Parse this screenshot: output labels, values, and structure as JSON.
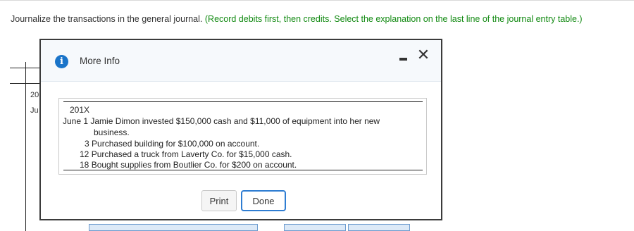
{
  "instruction": {
    "main": "Journalize the transactions in the general journal.",
    "hint": "(Record debits first, then credits. Select the explanation on the last line of the journal entry table.)"
  },
  "background": {
    "col_fragment_1": "20",
    "col_fragment_2": "Ju"
  },
  "modal": {
    "title": "More Info",
    "info_icon_glyph": "i",
    "close_glyph": "✕",
    "year": "201X",
    "transactions": [
      {
        "date": "June 1",
        "text": "Jamie Dimon invested $150,000 cash and $11,000 of equipment into her new",
        "continuation": "business."
      },
      {
        "date": "3",
        "text": "Purchased building for $100,000 on account."
      },
      {
        "date": "12",
        "text": "Purchased a truck from Laverty Co. for $15,000 cash."
      },
      {
        "date": "18",
        "text": "Bought supplies from Boutlier Co. for $200 on account."
      }
    ],
    "buttons": {
      "print": "Print",
      "done": "Done"
    }
  },
  "colors": {
    "hint": "#128a12",
    "info_icon": "#1a74c9",
    "done_border": "#2f7dd2"
  }
}
